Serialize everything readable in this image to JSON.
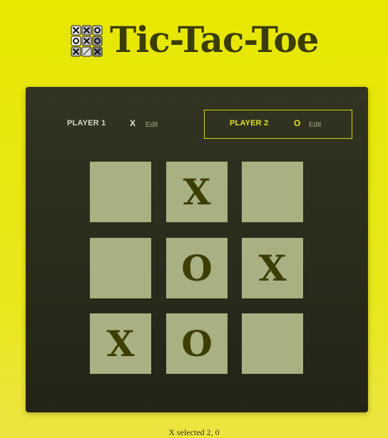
{
  "header": {
    "title": "Tic-Tac-Toe",
    "logo_icon": "tic-tac-toe-logo-icon"
  },
  "players": [
    {
      "label": "PLAYER 1",
      "symbol": "X",
      "edit_label": "Edit",
      "active": false
    },
    {
      "label": "PLAYER 2",
      "symbol": "O",
      "edit_label": "Edit",
      "active": true
    }
  ],
  "board": {
    "rows": [
      [
        "",
        "X",
        ""
      ],
      [
        "",
        "O",
        "X"
      ],
      [
        "X",
        "O",
        ""
      ]
    ]
  },
  "status": "X selected 2, 0",
  "colors": {
    "background": "#e7e700",
    "panel": "#2c2e1e",
    "cell": "#a9b081",
    "mark": "#3c3e05",
    "active_player": "#e3df25"
  }
}
